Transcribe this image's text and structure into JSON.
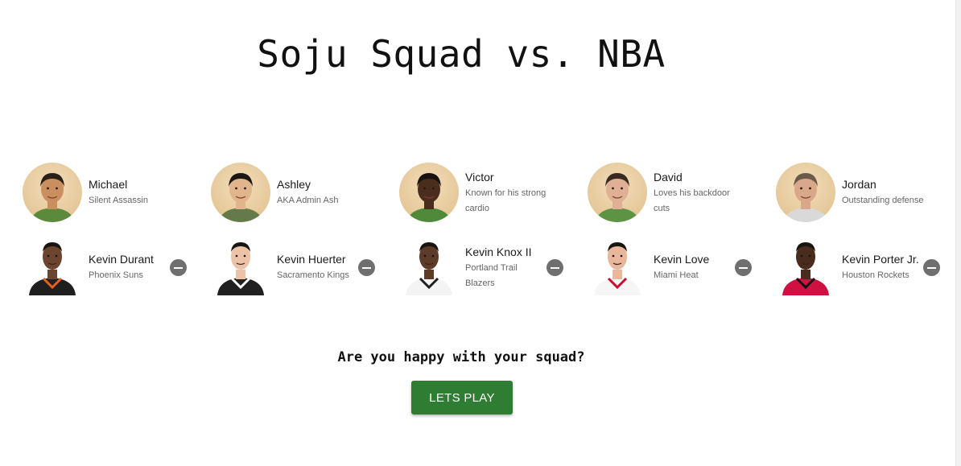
{
  "title": "Soju Squad vs. NBA",
  "columns": [
    {
      "squad": {
        "name": "Michael",
        "desc": "Silent Assassin",
        "shirt": "#5a8a3a",
        "skin": "#c98f5f",
        "hair": "#2b2018"
      },
      "nba": {
        "name": "Kevin Durant",
        "team": "Phoenix Suns",
        "jersey": "#1f1f1f",
        "trim": "#e56020",
        "skin": "#6b4530"
      }
    },
    {
      "squad": {
        "name": "Ashley",
        "desc": "AKA Admin Ash",
        "shirt": "#647a4a",
        "skin": "#e0b58c",
        "hair": "#1c1712"
      },
      "nba": {
        "name": "Kevin Huerter",
        "team": "Sacramento Kings",
        "jersey": "#202020",
        "trim": "#ffffff",
        "skin": "#edc3a7"
      }
    },
    {
      "squad": {
        "name": "Victor",
        "desc": "Known for his strong cardio",
        "shirt": "#4e8a3a",
        "skin": "#4a2d1d",
        "hair": "#1a1210"
      },
      "nba": {
        "name": "Kevin Knox II",
        "team": "Portland Trail Blazers",
        "jersey": "#f4f4f4",
        "trim": "#202020",
        "skin": "#5c3b28"
      }
    },
    {
      "squad": {
        "name": "David",
        "desc": "Loves his backdoor cuts",
        "shirt": "#5e9245",
        "skin": "#e0b095",
        "hair": "#3a2b20"
      },
      "nba": {
        "name": "Kevin Love",
        "team": "Miami Heat",
        "jersey": "#f6f6f6",
        "trim": "#c8102e",
        "skin": "#e8b79c"
      }
    },
    {
      "squad": {
        "name": "Jordan",
        "desc": "Outstanding defense",
        "shirt": "#d9d9d9",
        "skin": "#d9a78a",
        "hair": "#6a5a4a"
      },
      "nba": {
        "name": "Kevin Porter Jr.",
        "team": "Houston Rockets",
        "jersey": "#ce1141",
        "trim": "#111111",
        "skin": "#4a2c1e"
      }
    }
  ],
  "question": "Are you happy with your squad?",
  "play_button": "LETS PLAY",
  "colors": {
    "accent": "#2e7d32",
    "remove": "#6f6f6f"
  },
  "icons": {
    "remove": "minus-circle-icon"
  }
}
